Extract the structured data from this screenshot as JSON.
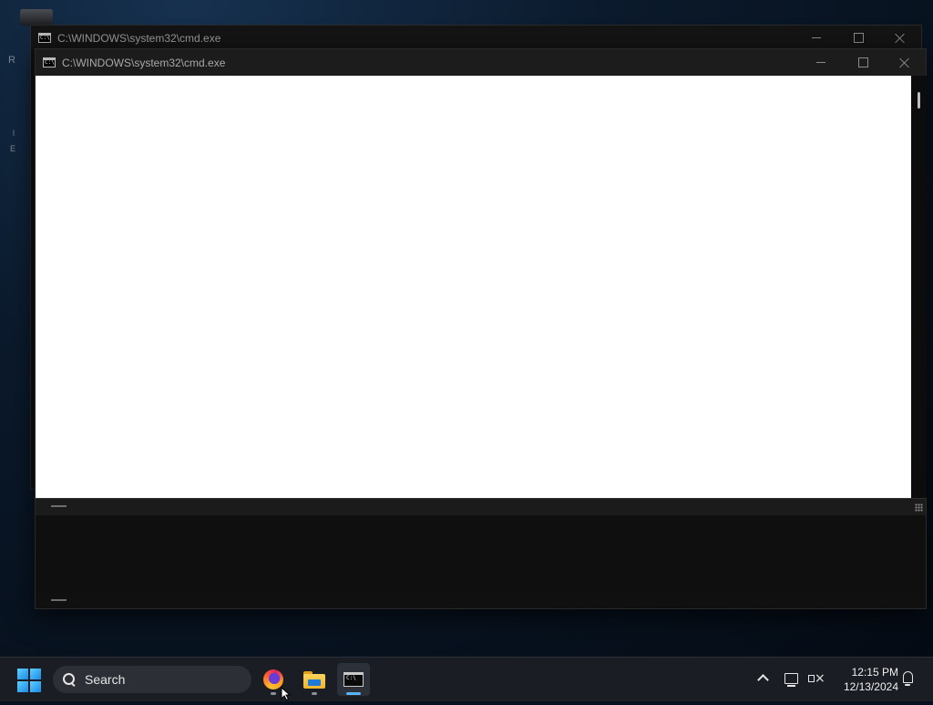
{
  "windows": {
    "back": {
      "title": "C:\\WINDOWS\\system32\\cmd.exe",
      "icon": "cmd-icon"
    },
    "front": {
      "title": "C:\\WINDOWS\\system32\\cmd.exe",
      "icon": "cmd-icon"
    }
  },
  "cmd_icon_glyph": "C:\\",
  "taskbar": {
    "search_label": "Search",
    "apps": [
      {
        "name": "Firefox",
        "icon": "firefox-icon"
      },
      {
        "name": "File Explorer",
        "icon": "folder-icon"
      },
      {
        "name": "Command Prompt",
        "icon": "terminal-icon",
        "active": true
      }
    ],
    "clock": {
      "time": "12:15 PM",
      "date": "12/13/2024"
    }
  },
  "desktop_fragments": [
    "R",
    "l",
    "E"
  ],
  "colors": {
    "accent": "#5ab3ff",
    "console_bg": "#0c0c0c",
    "taskbar_bg": "#1a1d24"
  }
}
